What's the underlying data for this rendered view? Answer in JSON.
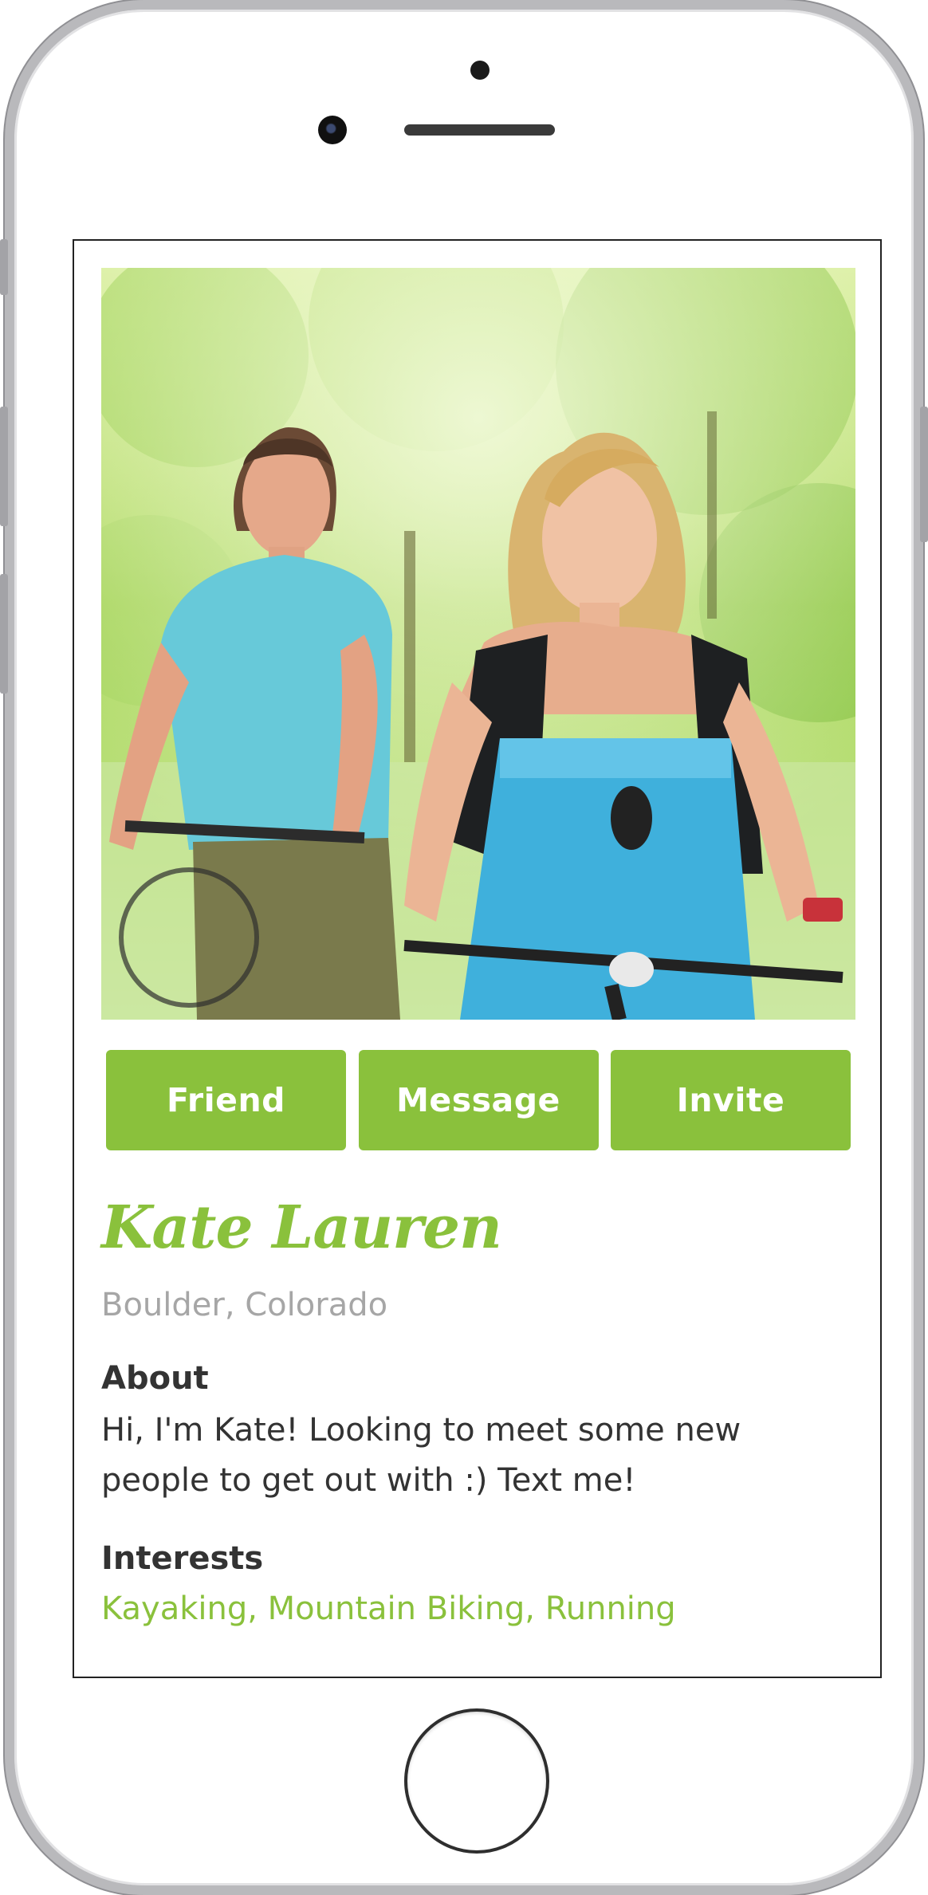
{
  "profile": {
    "photo_alt": "photo",
    "name": "Kate Lauren",
    "location": "Boulder, Colorado",
    "about_heading": "About",
    "about_text": "Hi, I'm Kate! Looking to meet some new people to get out with :) Text me!",
    "interests_heading": "Interests",
    "interests_text": "Kayaking, Mountain Biking, Running"
  },
  "actions": {
    "friend_label": "Friend",
    "message_label": "Message",
    "invite_label": "Invite"
  },
  "colors": {
    "accent": "#8ac13c",
    "muted": "#a6a6a6",
    "text": "#333333"
  }
}
